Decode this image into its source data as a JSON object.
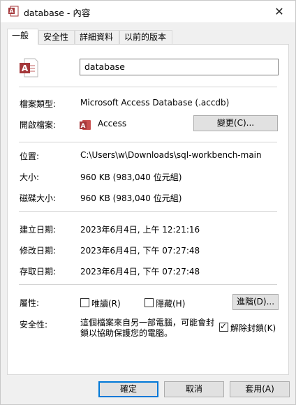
{
  "window": {
    "title": "database - 內容",
    "close_glyph": "✕"
  },
  "tabs": [
    {
      "label": "一般",
      "active": true
    },
    {
      "label": "安全性",
      "active": false
    },
    {
      "label": "詳細資料",
      "active": false
    },
    {
      "label": "以前的版本",
      "active": false
    }
  ],
  "general": {
    "file_name": "database",
    "file_type_label": "檔案類型:",
    "file_type_value": "Microsoft Access Database (.accdb)",
    "opens_with_label": "開啟檔案:",
    "opens_with_value": "Access",
    "change_button": "變更(C)...",
    "location_label": "位置:",
    "location_value": "C:\\Users\\w\\Downloads\\sql-workbench-main",
    "size_label": "大小:",
    "size_value": "960 KB (983,040 位元組)",
    "size_on_disk_label": "磁碟大小:",
    "size_on_disk_value": "960 KB (983,040 位元組)",
    "created_label": "建立日期:",
    "created_value": "2023年6月4日, 上午 12:21:16",
    "modified_label": "修改日期:",
    "modified_value": "2023年6月4日, 下午 07:27:48",
    "accessed_label": "存取日期:",
    "accessed_value": "2023年6月4日, 下午 07:27:48",
    "attributes_label": "屬性:",
    "readonly_label": "唯讀(R)",
    "readonly_checked": false,
    "hidden_label": "隱藏(H)",
    "hidden_checked": false,
    "advanced_button": "進階(D)...",
    "security_label": "安全性:",
    "security_text": "這個檔案來自另一部電腦，可能會封鎖以協助保護您的電腦。",
    "unblock_label": "解除封鎖(K)",
    "unblock_checked": true
  },
  "footer": {
    "ok": "確定",
    "cancel": "取消",
    "apply": "套用(A)"
  },
  "colors": {
    "access_red": "#a4373a",
    "accent": "#0078d7"
  }
}
